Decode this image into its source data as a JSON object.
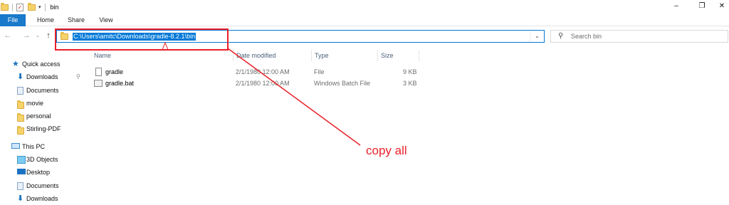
{
  "window": {
    "title": "bin",
    "controls": {
      "minimize": "–",
      "maximize": "❐",
      "close": "✕"
    }
  },
  "ribbon": {
    "tabs": [
      "File",
      "Home",
      "Share",
      "View"
    ]
  },
  "navigation": {
    "back": "←",
    "forward": "→",
    "recent": "⌄",
    "up": "↑",
    "address": "C:\\Users\\amitc\\Downloads\\gradle-8.2.1\\bin",
    "address_dropdown": "⌄",
    "refresh": "↻",
    "search_icon": "⚲",
    "search_placeholder": "Search bin"
  },
  "sidebar": {
    "items": [
      {
        "label": "Quick access",
        "icon": "star-icon"
      },
      {
        "label": "Downloads",
        "icon": "download-icon",
        "pin": "📌"
      },
      {
        "label": "Documents",
        "icon": "document-icon"
      },
      {
        "label": "movie",
        "icon": "folder-icon"
      },
      {
        "label": "personal",
        "icon": "folder-icon"
      },
      {
        "label": "Stirling-PDF",
        "icon": "folder-icon"
      },
      {
        "label": "This PC",
        "icon": "pc-icon"
      },
      {
        "label": "3D Objects",
        "icon": "cube-icon"
      },
      {
        "label": "Desktop",
        "icon": "desktop-icon"
      },
      {
        "label": "Documents",
        "icon": "document-icon"
      },
      {
        "label": "Downloads",
        "icon": "download-icon"
      }
    ]
  },
  "file_list": {
    "columns": [
      "Name",
      "Date modified",
      "Type",
      "Size"
    ],
    "rows": [
      {
        "name": "gradle",
        "date": "2/1/1980 12:00 AM",
        "type": "File",
        "size": "9 KB",
        "icon": "file-icon"
      },
      {
        "name": "gradle.bat",
        "date": "2/1/1980 12:00 AM",
        "type": "Windows Batch File",
        "size": "3 KB",
        "icon": "batch-file-icon"
      }
    ]
  },
  "annotation": {
    "text": "copy all",
    "color": "#e8202a"
  },
  "colors": {
    "accent": "#0078d7",
    "file_tab": "#1979ca",
    "annotation": "#e8202a"
  }
}
